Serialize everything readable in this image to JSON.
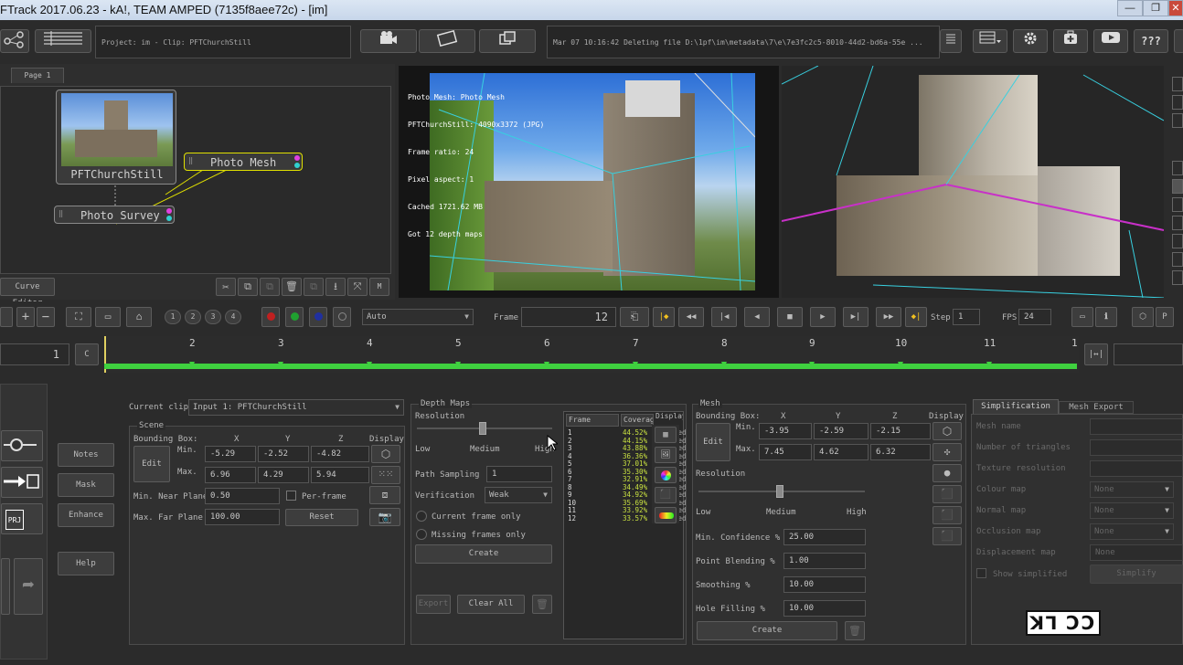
{
  "window": {
    "title": "FTrack 2017.06.23 - kA!, TEAM AMPED (7135f8aee72c) - [im]",
    "min": "—",
    "max": "❐",
    "close": "✕"
  },
  "header": {
    "project_clip": "Project: im - Clip: PFTChurchStill",
    "log_message": "Mar 07 10:16:42 Deleting file D:\\1pf\\im\\metadata\\7\\e\\7e3fc2c5-8010-44d2-bd6a-55e ...",
    "help_label": "???"
  },
  "node_editor": {
    "tab": "Page 1",
    "curve_editor": "Curve Editor",
    "nodes": {
      "clip": "PFTChurchStill",
      "mesh": "Photo Mesh",
      "survey": "Photo Survey"
    }
  },
  "viewer": {
    "overlay_lines": [
      "Photo Mesh: Photo Mesh",
      "PFTChurchStill: 4090x3372 (JPG)",
      "Frame ratio: 24",
      "Pixel aspect: 1",
      "Cached 1721.62 MB",
      "Got 12 depth maps"
    ]
  },
  "transport": {
    "layers": [
      "1",
      "2",
      "3",
      "4"
    ],
    "mode": "Auto",
    "frame_label": "Frame",
    "frame_value": "12",
    "step_label": "Step",
    "step_value": "1",
    "fps_label": "FPS",
    "fps_value": "24",
    "start_frame": "1",
    "c_label": "C",
    "x_label": "M"
  },
  "timeline": {
    "ticks": [
      "2",
      "3",
      "4",
      "5",
      "6",
      "7",
      "8",
      "9",
      "10",
      "11",
      "1"
    ]
  },
  "left_buttons": {
    "notes": "Notes",
    "mask": "Mask",
    "enhance": "Enhance",
    "help": "Help",
    "prj": "PRJ"
  },
  "current_clip": {
    "label": "Current clip",
    "value": "Input 1: PFTChurchStill"
  },
  "scene": {
    "title": "Scene",
    "bbox_label": "Bounding Box:",
    "cols": [
      "X",
      "Y",
      "Z",
      "Display"
    ],
    "min_label": "Min.",
    "max_label": "Max.",
    "min": [
      "-5.29",
      "-2.52",
      "-4.82"
    ],
    "max": [
      "6.96",
      "4.29",
      "5.94"
    ],
    "edit": "Edit",
    "near_label": "Min. Near Plane",
    "near_value": "0.50",
    "per_frame": "Per-frame",
    "far_label": "Max. Far Plane",
    "far_value": "100.00",
    "reset": "Reset"
  },
  "depth_maps": {
    "title": "Depth Maps",
    "resolution": "Resolution",
    "low": "Low",
    "medium": "Medium",
    "high": "High",
    "path_sampling_label": "Path Sampling",
    "path_sampling_value": "1",
    "verification_label": "Verification",
    "verification_value": "Weak",
    "current_frame_only": "Current frame only",
    "missing_frames_only": "Missing frames only",
    "create": "Create",
    "export": "Export",
    "clear_all": "Clear All",
    "table_headers": [
      "Frame",
      "Coverage",
      "Display"
    ],
    "rows": [
      {
        "frame": "1",
        "cov": "44.52%",
        "q": "Med"
      },
      {
        "frame": "2",
        "cov": "44.15%",
        "q": "Med"
      },
      {
        "frame": "3",
        "cov": "43.88%",
        "q": "Med"
      },
      {
        "frame": "4",
        "cov": "36.36%",
        "q": "Med"
      },
      {
        "frame": "5",
        "cov": "37.01%",
        "q": "Med"
      },
      {
        "frame": "6",
        "cov": "35.30%",
        "q": "Med"
      },
      {
        "frame": "7",
        "cov": "32.91%",
        "q": "Med"
      },
      {
        "frame": "8",
        "cov": "34.49%",
        "q": "Med"
      },
      {
        "frame": "9",
        "cov": "34.92%",
        "q": "Med"
      },
      {
        "frame": "10",
        "cov": "35.69%",
        "q": "Med"
      },
      {
        "frame": "11",
        "cov": "33.92%",
        "q": "Med"
      },
      {
        "frame": "12",
        "cov": "33.57%",
        "q": "Med"
      }
    ]
  },
  "mesh": {
    "title": "Mesh",
    "bbox_label": "Bounding Box:",
    "cols": [
      "X",
      "Y",
      "Z",
      "Display"
    ],
    "min_label": "Min.",
    "max_label": "Max.",
    "min": [
      "-3.95",
      "-2.59",
      "-2.15"
    ],
    "max": [
      "7.45",
      "4.62",
      "6.32"
    ],
    "edit": "Edit",
    "resolution": "Resolution",
    "low": "Low",
    "medium": "Medium",
    "high": "High",
    "min_conf_label": "Min. Confidence %",
    "min_conf_value": "25.00",
    "point_blend_label": "Point Blending %",
    "point_blend_value": "1.00",
    "smoothing_label": "Smoothing %",
    "smoothing_value": "10.00",
    "hole_label": "Hole Filling %",
    "hole_value": "10.00",
    "create": "Create"
  },
  "simplification": {
    "tab1": "Simplification",
    "tab2": "Mesh Export",
    "mesh_name": "Mesh name",
    "num_tri": "Number of triangles",
    "tex_res": "Texture resolution",
    "colour_map": "Colour map",
    "normal_map": "Normal map",
    "occlusion_map": "Occlusion map",
    "displacement_map": "Displacement map",
    "none": "None",
    "show_simplified": "Show simplified",
    "simplify": "Simplify"
  },
  "watermark": "ꓘ⅂ ƆƆ"
}
